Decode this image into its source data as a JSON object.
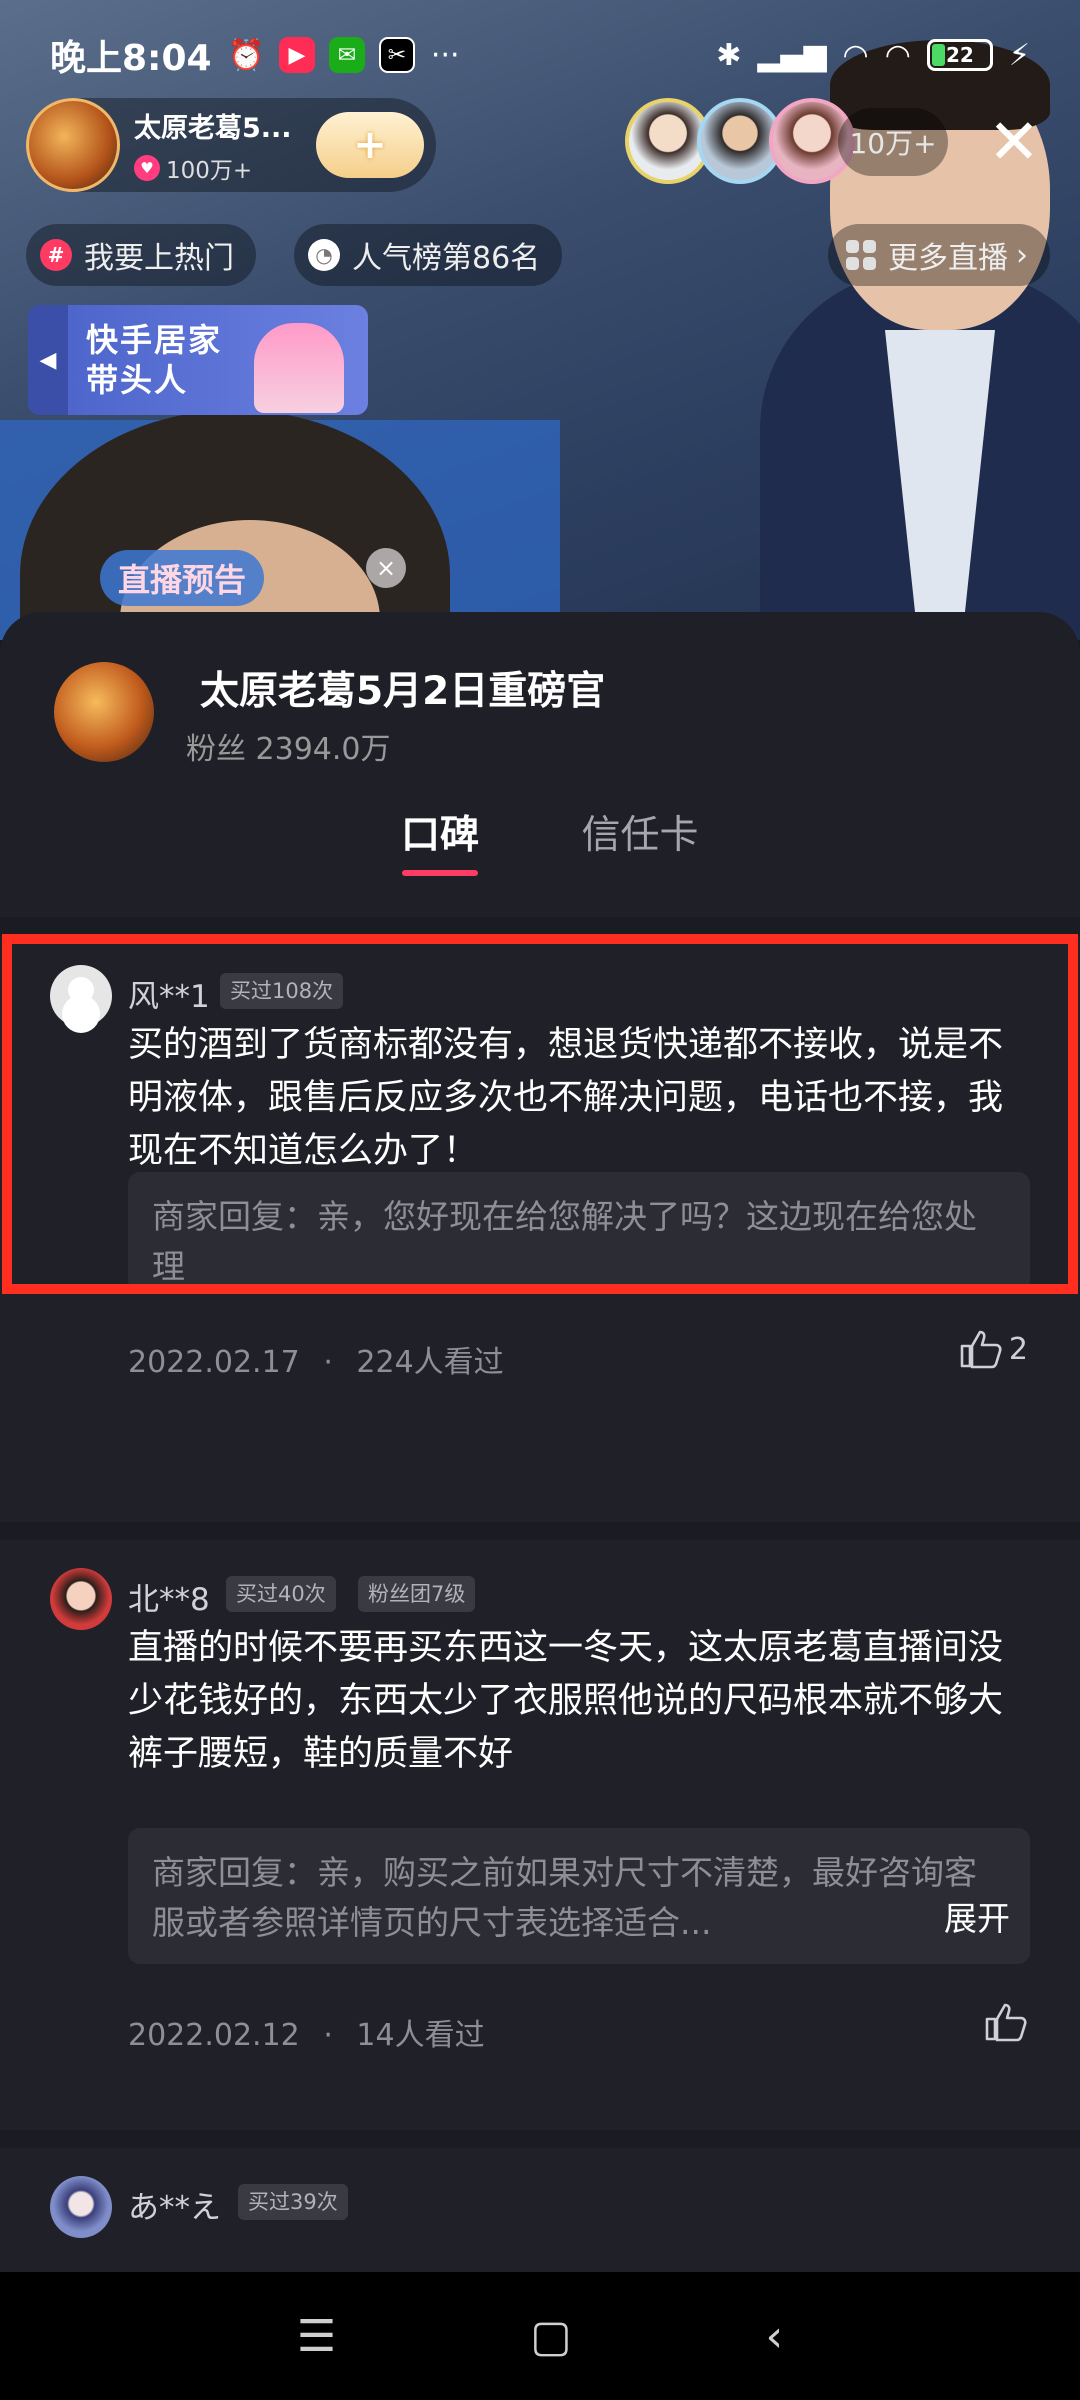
{
  "status_bar": {
    "time": "晚上8:04",
    "alarm_icon": "⏰",
    "more": "···",
    "battery": "22"
  },
  "live": {
    "streamer_name": "太原老葛5...",
    "streamer_likes": "100万+",
    "follow_label": "+",
    "viewer_count": "10万+",
    "close": "✕",
    "tags": {
      "hot": "我要上热门",
      "rank": "人气榜第86名",
      "more": "更多直播"
    },
    "banner": {
      "line1": "快手居家",
      "line2": "带头人"
    },
    "preview_badge": "直播预告"
  },
  "sheet": {
    "shop_name": "太原老葛5月2日重磅官",
    "fans": "粉丝 2394.0万",
    "tabs": [
      "口碑",
      "信任卡"
    ]
  },
  "reviews": [
    {
      "nickname": "风**1",
      "badges": [
        "买过108次"
      ],
      "content": "买的酒到了货商标都没有，想退货快递都不接收，说是不明液体，跟售后反应多次也不解决问题，电话也不接，我现在不知道怎么办了！",
      "reply": "商家回复：亲，您好现在给您解决了吗？这边现在给您处理",
      "date": "2022.02.17",
      "views": "224人看过",
      "likes": "2"
    },
    {
      "nickname": "北**8",
      "badges": [
        "买过40次",
        "粉丝团7级"
      ],
      "content": "直播的时候不要再买东西这一冬天，这太原老葛直播间没少花钱好的，东西太少了衣服照他说的尺码根本就不够大裤子腰短，鞋的质量不好",
      "reply": "商家回复：亲，购买之前如果对尺寸不清楚，最好咨询客服或者参照详情页的尺寸表选择适合...",
      "expand": "展开",
      "date": "2022.02.12",
      "views": "14人看过",
      "likes": ""
    },
    {
      "nickname": "あ**え",
      "badges": [
        "买过39次"
      ]
    }
  ],
  "separator": "·",
  "highlight_color": "#ff2e1f",
  "accent_color": "#ff3d64"
}
